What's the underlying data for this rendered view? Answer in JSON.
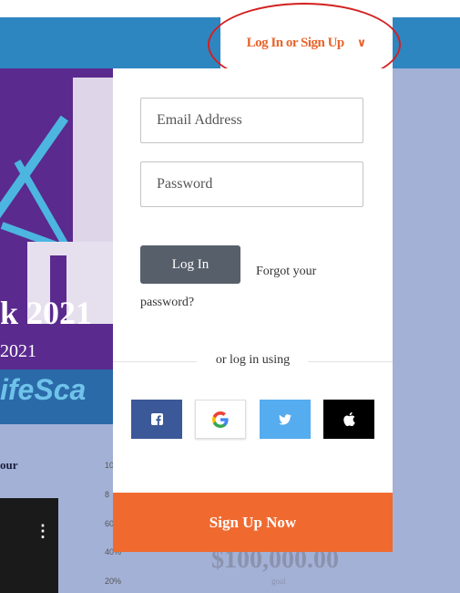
{
  "header": {
    "login_trigger_label": "Log In or Sign Up",
    "chevron_icon": "chevron-down-icon"
  },
  "banner": {
    "title": "k 2021",
    "year": "2021",
    "brand": "ifeSca"
  },
  "background": {
    "section_label": "our",
    "axis_ticks": [
      "10",
      "8",
      "60",
      "40%",
      "20%"
    ],
    "goal_amount": "$100,000.00",
    "goal_label": "goal"
  },
  "login_form": {
    "email_placeholder": "Email Address",
    "password_placeholder": "Password",
    "login_button": "Log In",
    "forgot_password": "Forgot your password?",
    "or_text": "or log in using",
    "social": [
      {
        "name": "facebook-icon",
        "color": "#3b5998"
      },
      {
        "name": "google-icon",
        "color": "#ffffff"
      },
      {
        "name": "twitter-icon",
        "color": "#55acee"
      },
      {
        "name": "apple-icon",
        "color": "#000000"
      }
    ],
    "signup_button": "Sign Up Now"
  },
  "colors": {
    "header": "#2e86c1",
    "accent": "#e8642c",
    "signup": "#f06a30",
    "page_bg": "#a3b1d6",
    "highlight_ellipse": "#d42020"
  }
}
